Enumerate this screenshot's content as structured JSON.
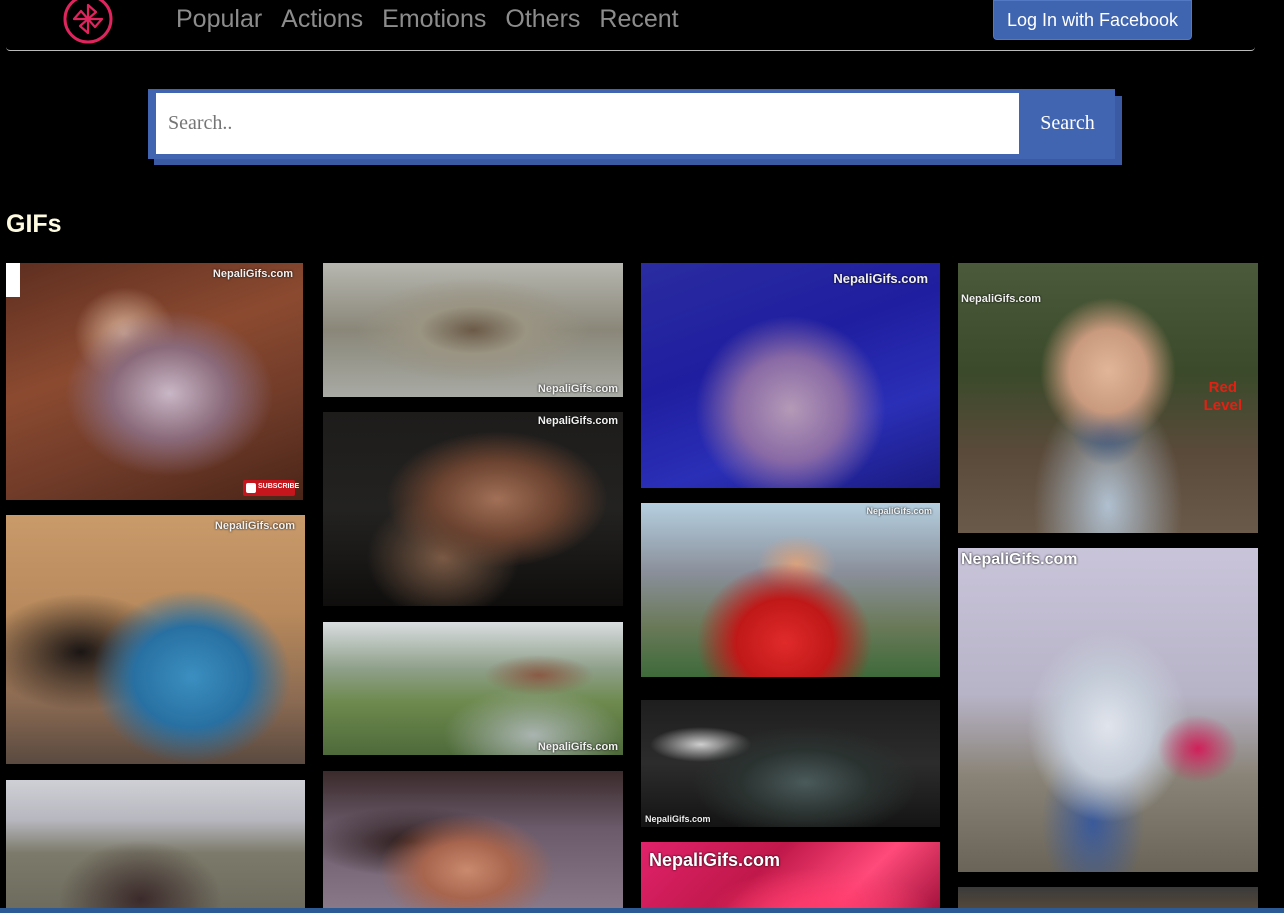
{
  "nav": {
    "logo_icon": "pinwheel-logo-icon",
    "links": [
      "Popular",
      "Actions",
      "Emotions",
      "Others",
      "Recent"
    ],
    "login_label": "Log In with Facebook"
  },
  "search": {
    "placeholder": "Search..",
    "button_label": "Search"
  },
  "section_title": "GIFs",
  "gifs": [
    {
      "watermark": "NepaliGifs.com",
      "subscribe": "SUBSCRIBE"
    },
    {
      "watermark": "NepaliGifs.com"
    },
    {
      "watermark": "NepaliGifs.com"
    },
    {
      "watermark": "NepaliGifs.com"
    },
    {
      "watermark": "NepaliGifs.com"
    },
    {
      "watermark": "NepaliGifs.com"
    },
    {
      "watermark": "NepaliGifs.com"
    },
    {
      "watermark": "NepaliGifs.com"
    },
    {
      "watermark": "NepaliGifs.com"
    },
    {
      "watermark": "NepaliGifs.com"
    },
    {
      "watermark": "NepaliGifs.com",
      "caption_line1": "Red",
      "caption_line2": "Level"
    },
    {
      "watermark": "NepaliGifs.com"
    }
  ],
  "colors": {
    "accent": "#4165b1",
    "logo": "#e0245e",
    "heading": "#fffbe0"
  }
}
